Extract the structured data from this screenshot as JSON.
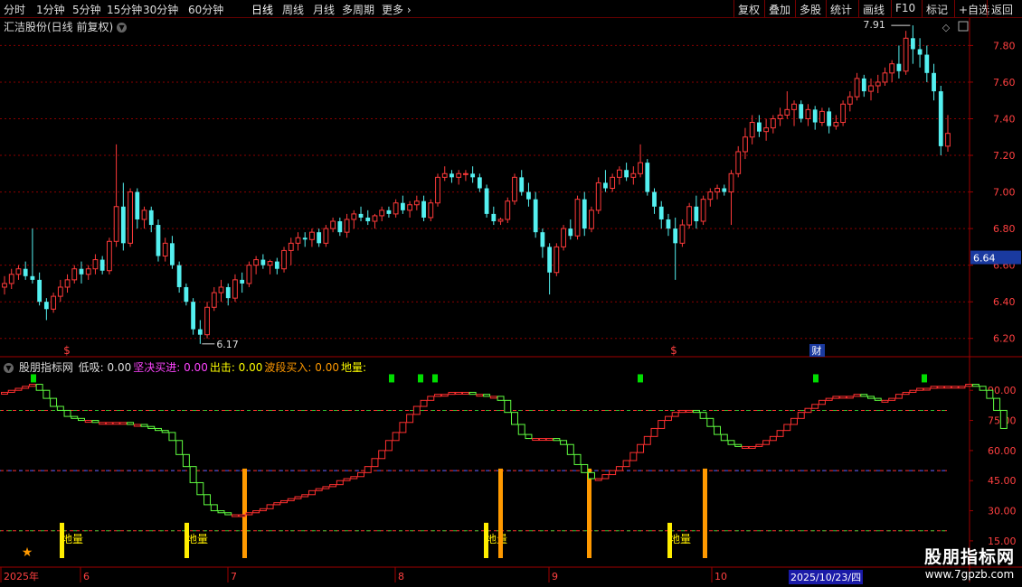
{
  "toolbar": {
    "timeframes": [
      "分时",
      "1分钟",
      "5分钟",
      "15分钟",
      "30分钟",
      "60分钟",
      "日线",
      "周线",
      "月线",
      "多周期",
      "更多"
    ],
    "active": "日线",
    "right_buttons": [
      "复权",
      "叠加",
      "多股",
      "统计",
      "画线",
      "F10",
      "标记",
      "+自选",
      "返回"
    ]
  },
  "stock": {
    "title": "汇洁股份(日线 前复权)"
  },
  "price_panel": {
    "y_ticks": [
      "7.80",
      "7.60",
      "7.40",
      "7.20",
      "7.00",
      "6.80",
      "6.60",
      "6.40",
      "6.20"
    ],
    "current_price": "6.64",
    "high_label": "7.91",
    "low_label": "6.17",
    "event_markers": [
      "$",
      "$",
      "财"
    ]
  },
  "indicator": {
    "name": "股朋指标网",
    "legend": [
      {
        "label": "低吸:",
        "value": "0.00",
        "color": "#dddddd"
      },
      {
        "label": "坚决买进:",
        "value": "0.00",
        "color": "#ff44ff"
      },
      {
        "label": "出击:",
        "value": "0.00",
        "color": "#ffff00"
      },
      {
        "label": "波段买入:",
        "value": "0.00",
        "color": "#ff9900"
      },
      {
        "label": "地量:",
        "value": "",
        "color": "#ffff00"
      }
    ],
    "y_ticks": [
      "90.00",
      "75.00",
      "60.00",
      "45.00",
      "30.00",
      "15.00"
    ],
    "diliang_label": "地量"
  },
  "x_axis": {
    "labels": [
      "2025年",
      "6",
      "7",
      "8",
      "9",
      "10"
    ],
    "cursor_date": "2025/10/23/四"
  },
  "watermark": {
    "title": "股朋指标网",
    "url": "www.7gpzb.com"
  },
  "chart_data": [
    {
      "type": "candlestick",
      "title": "汇洁股份(日线 前复权)",
      "ylim": [
        6.1,
        7.95
      ],
      "candles": [
        [
          6.48,
          6.54,
          6.44,
          6.5
        ],
        [
          6.5,
          6.58,
          6.47,
          6.55
        ],
        [
          6.55,
          6.6,
          6.52,
          6.58
        ],
        [
          6.58,
          6.62,
          6.52,
          6.54
        ],
        [
          6.54,
          6.8,
          6.5,
          6.52
        ],
        [
          6.52,
          6.56,
          6.38,
          6.4
        ],
        [
          6.4,
          6.42,
          6.3,
          6.36
        ],
        [
          6.36,
          6.45,
          6.34,
          6.43
        ],
        [
          6.43,
          6.52,
          6.4,
          6.48
        ],
        [
          6.48,
          6.55,
          6.45,
          6.52
        ],
        [
          6.52,
          6.6,
          6.5,
          6.58
        ],
        [
          6.58,
          6.62,
          6.5,
          6.55
        ],
        [
          6.55,
          6.6,
          6.52,
          6.58
        ],
        [
          6.58,
          6.66,
          6.55,
          6.63
        ],
        [
          6.63,
          6.65,
          6.55,
          6.57
        ],
        [
          6.57,
          6.75,
          6.55,
          6.73
        ],
        [
          6.73,
          7.26,
          6.7,
          6.92
        ],
        [
          6.92,
          7.05,
          6.68,
          6.72
        ],
        [
          6.72,
          7.02,
          6.7,
          7.0
        ],
        [
          7.0,
          7.02,
          6.8,
          6.85
        ],
        [
          6.85,
          6.92,
          6.8,
          6.9
        ],
        [
          6.9,
          6.92,
          6.78,
          6.82
        ],
        [
          6.82,
          6.85,
          6.62,
          6.65
        ],
        [
          6.65,
          6.75,
          6.62,
          6.72
        ],
        [
          6.72,
          6.76,
          6.58,
          6.6
        ],
        [
          6.6,
          6.62,
          6.45,
          6.48
        ],
        [
          6.48,
          6.5,
          6.38,
          6.4
        ],
        [
          6.4,
          6.42,
          6.22,
          6.25
        ],
        [
          6.25,
          6.3,
          6.17,
          6.22
        ],
        [
          6.22,
          6.4,
          6.2,
          6.37
        ],
        [
          6.37,
          6.48,
          6.35,
          6.45
        ],
        [
          6.45,
          6.52,
          6.4,
          6.48
        ],
        [
          6.48,
          6.5,
          6.38,
          6.42
        ],
        [
          6.42,
          6.55,
          6.4,
          6.52
        ],
        [
          6.52,
          6.56,
          6.45,
          6.5
        ],
        [
          6.5,
          6.62,
          6.48,
          6.6
        ],
        [
          6.6,
          6.65,
          6.55,
          6.63
        ],
        [
          6.63,
          6.66,
          6.58,
          6.6
        ],
        [
          6.6,
          6.63,
          6.55,
          6.62
        ],
        [
          6.62,
          6.64,
          6.55,
          6.58
        ],
        [
          6.58,
          6.7,
          6.56,
          6.68
        ],
        [
          6.68,
          6.75,
          6.6,
          6.72
        ],
        [
          6.72,
          6.78,
          6.68,
          6.75
        ],
        [
          6.75,
          6.78,
          6.7,
          6.74
        ],
        [
          6.74,
          6.8,
          6.7,
          6.78
        ],
        [
          6.78,
          6.8,
          6.7,
          6.72
        ],
        [
          6.72,
          6.82,
          6.7,
          6.8
        ],
        [
          6.8,
          6.86,
          6.78,
          6.84
        ],
        [
          6.84,
          6.86,
          6.76,
          6.78
        ],
        [
          6.78,
          6.88,
          6.75,
          6.85
        ],
        [
          6.85,
          6.9,
          6.8,
          6.88
        ],
        [
          6.88,
          6.92,
          6.84,
          6.86
        ],
        [
          6.86,
          6.9,
          6.82,
          6.84
        ],
        [
          6.84,
          6.88,
          6.8,
          6.87
        ],
        [
          6.87,
          6.92,
          6.84,
          6.9
        ],
        [
          6.9,
          6.92,
          6.86,
          6.88
        ],
        [
          6.88,
          6.96,
          6.86,
          6.94
        ],
        [
          6.94,
          6.98,
          6.88,
          6.9
        ],
        [
          6.9,
          6.95,
          6.86,
          6.93
        ],
        [
          6.93,
          6.98,
          6.9,
          6.95
        ],
        [
          6.95,
          6.98,
          6.84,
          6.86
        ],
        [
          6.86,
          6.96,
          6.84,
          6.94
        ],
        [
          6.94,
          7.1,
          6.92,
          7.08
        ],
        [
          7.08,
          7.14,
          7.06,
          7.1
        ],
        [
          7.1,
          7.12,
          7.05,
          7.08
        ],
        [
          7.08,
          7.12,
          7.04,
          7.1
        ],
        [
          7.1,
          7.12,
          7.06,
          7.1
        ],
        [
          7.1,
          7.14,
          7.05,
          7.08
        ],
        [
          7.08,
          7.1,
          7.0,
          7.02
        ],
        [
          7.02,
          7.04,
          6.86,
          6.88
        ],
        [
          6.88,
          6.92,
          6.82,
          6.84
        ],
        [
          6.84,
          6.86,
          6.82,
          6.85
        ],
        [
          6.85,
          6.97,
          6.83,
          6.95
        ],
        [
          6.95,
          7.1,
          6.93,
          7.08
        ],
        [
          7.08,
          7.12,
          6.98,
          7.0
        ],
        [
          7.0,
          7.05,
          6.92,
          6.96
        ],
        [
          6.96,
          7.0,
          6.75,
          6.78
        ],
        [
          6.78,
          6.8,
          6.64,
          6.7
        ],
        [
          6.7,
          6.72,
          6.44,
          6.56
        ],
        [
          6.56,
          6.72,
          6.54,
          6.7
        ],
        [
          6.7,
          6.82,
          6.68,
          6.8
        ],
        [
          6.8,
          6.85,
          6.74,
          6.76
        ],
        [
          6.76,
          6.98,
          6.74,
          6.96
        ],
        [
          6.96,
          7.0,
          6.76,
          6.8
        ],
        [
          6.8,
          6.92,
          6.78,
          6.9
        ],
        [
          6.9,
          7.08,
          6.88,
          7.05
        ],
        [
          7.05,
          7.12,
          7.0,
          7.02
        ],
        [
          7.02,
          7.1,
          7.0,
          7.08
        ],
        [
          7.08,
          7.14,
          7.04,
          7.12
        ],
        [
          7.12,
          7.16,
          7.06,
          7.08
        ],
        [
          7.08,
          7.14,
          7.04,
          7.1
        ],
        [
          7.1,
          7.26,
          7.08,
          7.16
        ],
        [
          7.16,
          7.18,
          6.98,
          7.0
        ],
        [
          7.0,
          7.02,
          6.88,
          6.92
        ],
        [
          6.92,
          6.95,
          6.8,
          6.85
        ],
        [
          6.85,
          6.88,
          6.76,
          6.8
        ],
        [
          6.8,
          6.86,
          6.52,
          6.72
        ],
        [
          6.72,
          6.85,
          6.7,
          6.82
        ],
        [
          6.82,
          6.94,
          6.8,
          6.92
        ],
        [
          6.92,
          6.98,
          6.8,
          6.84
        ],
        [
          6.84,
          6.98,
          6.82,
          6.96
        ],
        [
          6.96,
          7.02,
          6.92,
          7.0
        ],
        [
          7.0,
          7.04,
          6.96,
          7.02
        ],
        [
          7.02,
          7.04,
          6.98,
          7.0
        ],
        [
          7.0,
          7.12,
          6.82,
          7.1
        ],
        [
          7.1,
          7.25,
          7.08,
          7.22
        ],
        [
          7.22,
          7.35,
          7.18,
          7.3
        ],
        [
          7.3,
          7.42,
          7.26,
          7.38
        ],
        [
          7.38,
          7.42,
          7.3,
          7.33
        ],
        [
          7.33,
          7.4,
          7.28,
          7.35
        ],
        [
          7.35,
          7.42,
          7.32,
          7.4
        ],
        [
          7.4,
          7.46,
          7.36,
          7.42
        ],
        [
          7.42,
          7.55,
          7.4,
          7.45
        ],
        [
          7.45,
          7.5,
          7.36,
          7.48
        ],
        [
          7.48,
          7.5,
          7.38,
          7.4
        ],
        [
          7.4,
          7.48,
          7.36,
          7.45
        ],
        [
          7.45,
          7.47,
          7.34,
          7.38
        ],
        [
          7.38,
          7.46,
          7.36,
          7.44
        ],
        [
          7.44,
          7.46,
          7.32,
          7.36
        ],
        [
          7.36,
          7.42,
          7.34,
          7.38
        ],
        [
          7.38,
          7.5,
          7.36,
          7.48
        ],
        [
          7.48,
          7.55,
          7.44,
          7.52
        ],
        [
          7.52,
          7.65,
          7.5,
          7.62
        ],
        [
          7.62,
          7.64,
          7.52,
          7.55
        ],
        [
          7.55,
          7.62,
          7.5,
          7.58
        ],
        [
          7.58,
          7.64,
          7.54,
          7.6
        ],
        [
          7.6,
          7.68,
          7.58,
          7.65
        ],
        [
          7.65,
          7.72,
          7.6,
          7.7
        ],
        [
          7.7,
          7.8,
          7.62,
          7.66
        ],
        [
          7.66,
          7.88,
          7.64,
          7.84
        ],
        [
          7.84,
          7.91,
          7.7,
          7.78
        ],
        [
          7.78,
          7.84,
          7.68,
          7.75
        ],
        [
          7.75,
          7.8,
          7.6,
          7.65
        ],
        [
          7.65,
          7.7,
          7.5,
          7.55
        ],
        [
          7.55,
          7.58,
          7.2,
          7.25
        ],
        [
          7.25,
          7.42,
          7.22,
          7.32
        ]
      ]
    },
    {
      "type": "line",
      "title": "股朋指标网",
      "ylim": [
        10,
        100
      ],
      "series": [
        {
          "values": [
            89,
            90,
            91,
            92,
            93,
            90,
            86,
            82,
            80,
            77,
            76,
            75,
            75,
            74,
            74,
            74,
            74,
            74,
            73,
            73,
            72,
            71,
            70,
            69,
            65,
            58,
            52,
            44,
            38,
            33,
            30,
            29,
            28,
            28,
            28,
            29,
            30,
            31,
            33,
            34,
            35,
            36,
            37,
            38,
            40,
            41,
            42,
            43,
            45,
            46,
            47,
            49,
            52,
            56,
            60,
            65,
            69,
            74,
            78,
            82,
            85,
            87,
            88,
            88,
            89,
            89,
            89,
            88,
            88,
            87,
            87,
            85,
            79,
            73,
            68,
            66,
            66,
            66,
            66,
            65,
            63,
            58,
            53,
            49,
            46,
            46,
            48,
            50,
            52,
            55,
            59,
            63,
            67,
            71,
            75,
            77,
            79,
            80,
            80,
            79,
            76,
            72,
            68,
            65,
            63,
            62,
            62,
            62,
            63,
            65,
            67,
            70,
            73,
            76,
            79,
            81,
            83,
            85,
            86,
            87,
            87,
            87,
            88,
            87,
            86,
            85,
            85,
            86,
            88,
            89,
            90,
            91,
            91,
            92,
            92,
            92,
            92,
            92,
            93,
            92,
            90,
            86,
            80,
            71
          ]
        }
      ]
    }
  ]
}
